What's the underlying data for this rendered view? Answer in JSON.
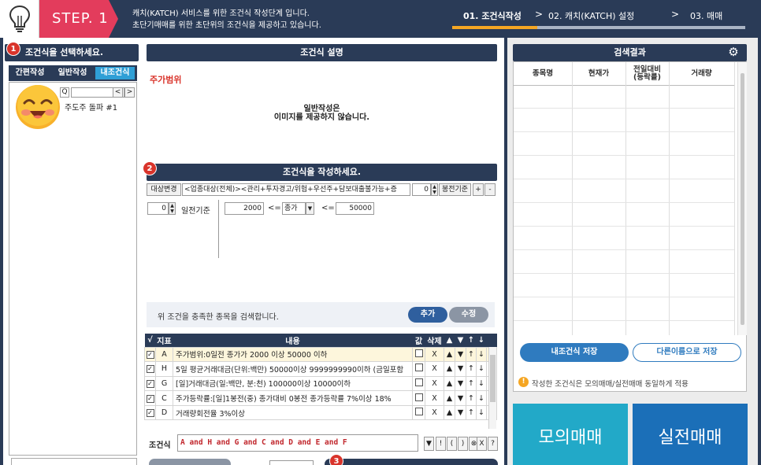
{
  "header": {
    "step_label": "STEP. 1",
    "desc_line1": "캐치(KATCH) 서비스를 위한 조건식 작성단계 입니다.",
    "desc_line2": "초단기매매를 위한 초단위의 조건식을 제공하고 있습니다.",
    "steps": [
      "01. 조건식작성",
      "02. 캐치(KATCH) 설정",
      "03. 매매"
    ],
    "arrow": ">",
    "progress": 0.29
  },
  "left": {
    "badge": "1",
    "title": "조건식을 선택하세요.",
    "tabs": [
      "간편작성",
      "일반작성",
      "내조건식"
    ],
    "active_tab": "내조건식",
    "search_glyph": "Q",
    "nav_prev": "<",
    "nav_next": ">",
    "tree_item": "주도주 돌파 #1"
  },
  "description": {
    "title": "조건식 설명",
    "condition_name": "주가범위",
    "msg_line1": "일반작성은",
    "msg_line2": "이미지를 제공하지 않습니다."
  },
  "builder": {
    "badge": "2",
    "title": "조건식을 작성하세요.",
    "target_btn": "대상변경",
    "target_value": "<업종대상(전체)><관리+투자경고/위험+우선주+담보대출불가능+증",
    "bar_count": "0",
    "bar_unit": "봉전기준",
    "plus": "+",
    "minus": "-",
    "day_count": "0",
    "day_unit": "일전기준",
    "min_value": "2000",
    "op1": "<=",
    "field": "종가",
    "dropdown_glyph": "▼",
    "op2": "<=",
    "max_value": "50000",
    "search_hint": "위 조건을 충족한 종목을 검색합니다.",
    "add_btn": "추가",
    "edit_btn": "수정"
  },
  "cond_table": {
    "headers": [
      "√",
      "지표",
      "내용",
      "값",
      "삭제",
      "▲",
      "▼",
      "↑",
      "↓"
    ],
    "rows": [
      {
        "id": "A",
        "content": "주가범위:0일전 종가가 2000 이상 50000 이하",
        "del": "X",
        "up": "▲",
        "down": "▼",
        "top": "↑",
        "bottom": "↓"
      },
      {
        "id": "H",
        "content": "5일 평균거래대금(단위:백만) 50000이상 9999999990이하 (금일포함",
        "del": "X",
        "up": "▲",
        "down": "▼",
        "top": "↑",
        "bottom": "↓"
      },
      {
        "id": "G",
        "content": "[일]거래대금(일:백만, 분:천) 100000이상 10000이하",
        "del": "X",
        "up": "▲",
        "down": "▼",
        "top": "↑",
        "bottom": "↓"
      },
      {
        "id": "C",
        "content": "주가등락률:[일]1봉전(중) 종가대비 0봉전 종가등락률 7%이상 18%",
        "del": "X",
        "up": "▲",
        "down": "▼",
        "top": "↑",
        "bottom": "↓"
      },
      {
        "id": "D",
        "content": "거래량회전율 3%이상",
        "del": "X",
        "up": "▲",
        "down": "▼",
        "top": "↑",
        "bottom": "↓"
      }
    ],
    "check_glyph": "✓"
  },
  "formula": {
    "label": "조건식",
    "value": "A and H and G and C and D and E and F",
    "ops": [
      "▼",
      "!",
      "(",
      ")",
      "⊗",
      "X",
      "?"
    ]
  },
  "bottom": {
    "badge": "3"
  },
  "results": {
    "title": "검색결과",
    "gear_glyph": "⚙",
    "columns": [
      "종목명",
      "현재가",
      "전일대비\n(등락률)",
      "거래량"
    ],
    "save_btn": "내조건식 저장",
    "saveas_btn": "다른이름으로 저장",
    "notice_glyph": "!",
    "notice": "작성한 조건식은 모의매매/실전매매 동일하게 적용"
  },
  "trade": {
    "mock": "모의매매",
    "real": "실전매매"
  },
  "colors": {
    "navy": "#2a3b57",
    "step_red": "#e33c5c",
    "accent_blue": "#2f9fd6",
    "progress_orange": "#f5a623",
    "mock_cyan": "#22a9c8",
    "real_blue": "#1b6fb8"
  }
}
